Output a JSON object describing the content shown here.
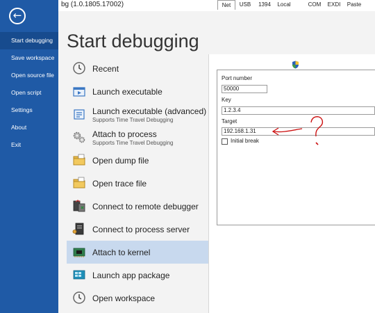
{
  "window": {
    "title": "bg (1.0.1805.17002)"
  },
  "sidebar": {
    "back_icon": "back-arrow-icon",
    "items": [
      {
        "label": "Start debugging",
        "active": true
      },
      {
        "label": "Save workspace",
        "active": false
      },
      {
        "label": "Open source file",
        "active": false
      },
      {
        "label": "Open script",
        "active": false
      },
      {
        "label": "Settings",
        "active": false
      },
      {
        "label": "About",
        "active": false
      },
      {
        "label": "Exit",
        "active": false
      }
    ]
  },
  "main": {
    "title": "Start debugging",
    "options": [
      {
        "label": "Recent",
        "sub": "",
        "icon": "clock-icon"
      },
      {
        "label": "Launch executable",
        "sub": "",
        "icon": "launch-executable-icon"
      },
      {
        "label": "Launch executable (advanced)",
        "sub": "Supports Time Travel Debugging",
        "icon": "launch-advanced-icon"
      },
      {
        "label": "Attach to process",
        "sub": "Supports Time Travel Debugging",
        "icon": "gears-icon"
      },
      {
        "label": "Open dump file",
        "sub": "",
        "icon": "dump-file-icon"
      },
      {
        "label": "Open trace file",
        "sub": "",
        "icon": "trace-file-icon"
      },
      {
        "label": "Connect to remote debugger",
        "sub": "",
        "icon": "remote-debugger-icon"
      },
      {
        "label": "Connect to process server",
        "sub": "",
        "icon": "process-server-icon"
      },
      {
        "label": "Attach to kernel",
        "sub": "",
        "icon": "kernel-chip-icon",
        "selected": true
      },
      {
        "label": "Launch app package",
        "sub": "",
        "icon": "app-package-icon"
      },
      {
        "label": "Open workspace",
        "sub": "",
        "icon": "clock-icon"
      }
    ]
  },
  "kernel": {
    "tabs": [
      "Net",
      "USB",
      "1394",
      "Local",
      "COM",
      "EXDI",
      "Paste"
    ],
    "active_tab": "Net",
    "port_label": "Port number",
    "port_value": "50000",
    "key_label": "Key",
    "key_value": "1.2.3.4",
    "target_label": "Target",
    "target_value": "192.168.1.31",
    "initial_break_label": "Initial break",
    "initial_break_checked": false
  },
  "colors": {
    "sidebar_bg": "#1f5aa6",
    "sidebar_active": "#174b8e",
    "selected_option": "#c8d9ee",
    "annotation": "#cc1111"
  }
}
